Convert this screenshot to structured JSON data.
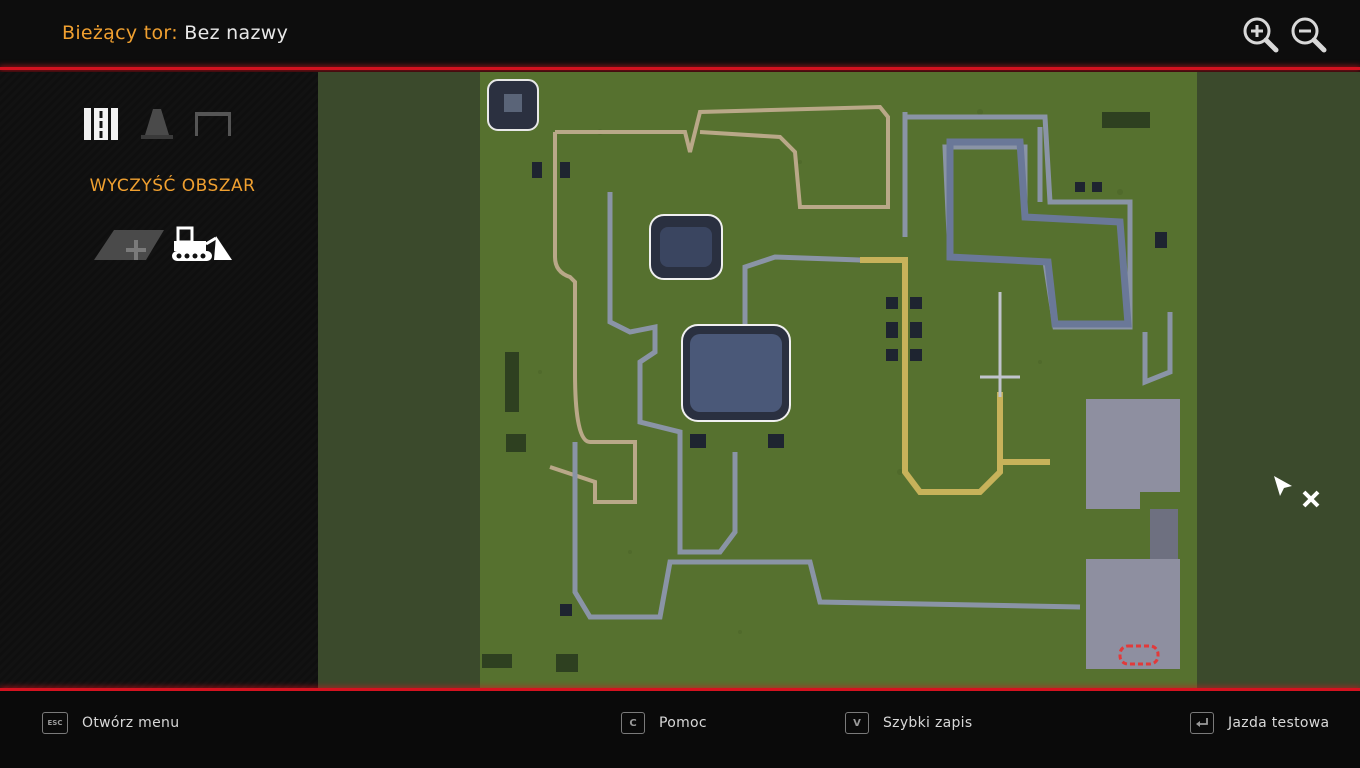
{
  "header": {
    "track_label": "Bieżący tor:",
    "track_name": "Bez nazwy",
    "zoom_in_icon": "zoom-in-icon",
    "zoom_out_icon": "zoom-out-icon"
  },
  "sidebar": {
    "category_icons": [
      "road-tiles-icon",
      "traffic-cone-icon",
      "barrier-frame-icon"
    ],
    "heading": "WYCZYŚĆ OBSZAR",
    "tool_icons": [
      "add-terrain-icon",
      "bulldozer-icon"
    ]
  },
  "footer": {
    "menu": {
      "key": "ESC",
      "label": "Otwórz menu"
    },
    "help": {
      "key": "C",
      "label": "Pomoc"
    },
    "quicksave": {
      "key": "V",
      "label": "Szybki zapis"
    },
    "testdrive": {
      "key_icon": "enter-key-icon",
      "label": "Jazda testowa"
    }
  },
  "colors": {
    "accent": "#f0a030",
    "red_line": "#d4121f",
    "grass": "#56712f",
    "margin": "#3b4a2c"
  }
}
